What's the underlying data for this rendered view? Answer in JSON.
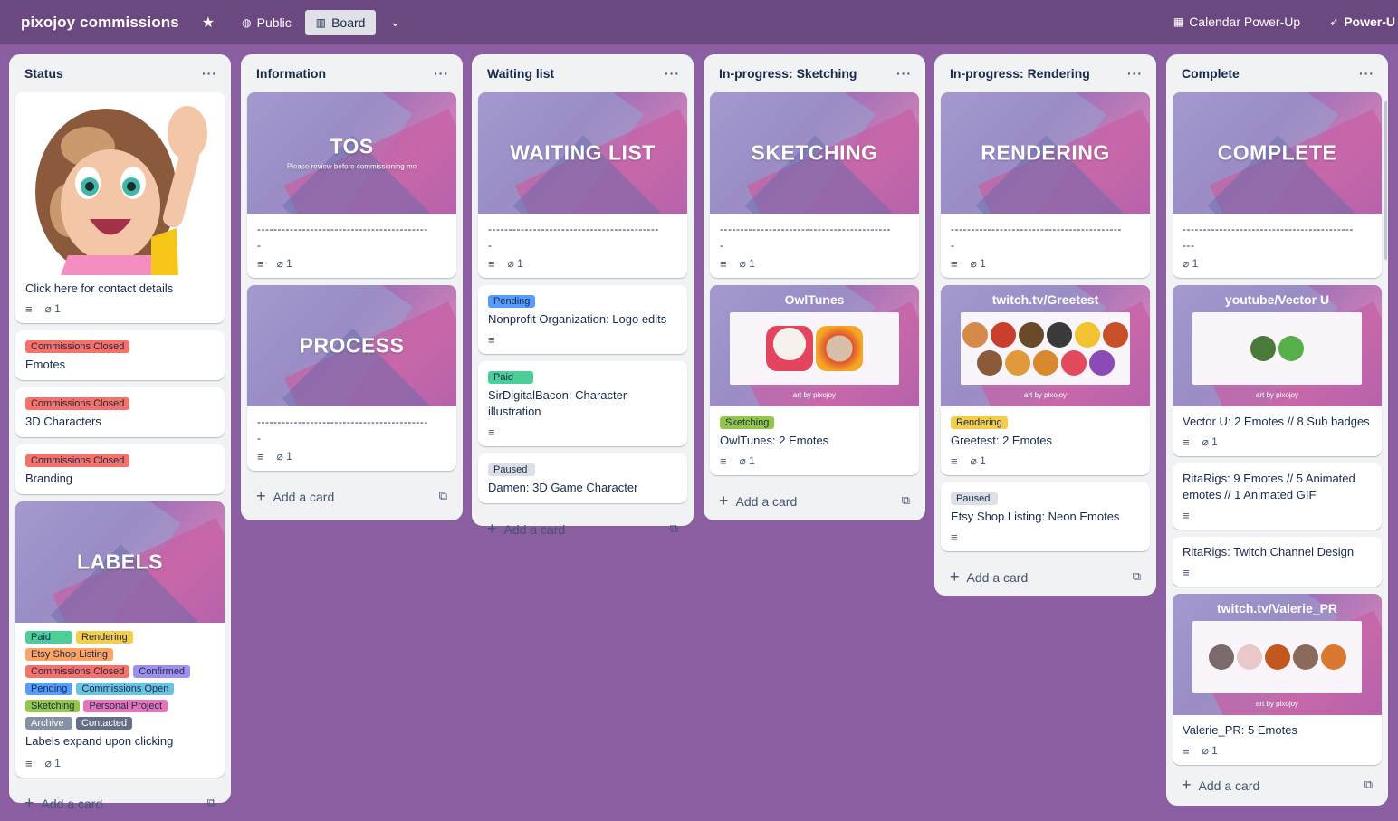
{
  "topbar": {
    "title": "pixojoy commissions",
    "visibility": "Public",
    "view": "Board",
    "calendar": "Calendar Power-Up",
    "powerups": "Power-U"
  },
  "colors": {
    "green": "#4bce97",
    "yellow": "#f5cd47",
    "orange": "#fea362",
    "red": "#f87168",
    "purple": "#9f8fef",
    "blue": "#579dff",
    "sky": "#6cc3e0",
    "lime": "#94c748",
    "pink": "#e774bb",
    "gray": "#8590a2",
    "dark": "#626f86",
    "paused": "#dcdfe4"
  },
  "lists": {
    "status": {
      "title": "Status",
      "card1": "Click here for contact details",
      "card1_att": "1",
      "emotes": {
        "label": "Commissions Closed",
        "title": "Emotes"
      },
      "chars": {
        "label": "Commissions Closed",
        "title": "3D Characters"
      },
      "brand": {
        "label": "Commissions Closed",
        "title": "Branding"
      },
      "labels_cover": "LABELS",
      "labels": [
        "Paid",
        "Rendering",
        "Etsy Shop Listing",
        "Commissions Closed",
        "Confirmed",
        "Pending",
        "Commissions Open",
        "Sketching",
        "Personal Project",
        "Archive",
        "Contacted"
      ],
      "labels_title": "Labels expand upon clicking",
      "labels_att": "1",
      "add": "Add a card"
    },
    "info": {
      "title": "Information",
      "tos_cover": "TOS",
      "tos_sub": "Please review before commissioning me",
      "tos_dash": "------------------------------------------",
      "tos_dash2": "-",
      "tos_att": "1",
      "process_cover": "PROCESS",
      "process_dash": "------------------------------------------",
      "process_dash2": "-",
      "process_att": "1",
      "add": "Add a card"
    },
    "waiting": {
      "title": "Waiting list",
      "cover": "WAITING LIST",
      "dash": "------------------------------------------",
      "dash2": "-",
      "att": "1",
      "c1_label": "Pending",
      "c1_title": "Nonprofit Organization: Logo edits",
      "c2_label": "Paid",
      "c2_title": "SirDigitalBacon: Character illustration",
      "c3_label": "Paused",
      "c3_title": "Damen: 3D Game Character",
      "add": "Add a card"
    },
    "sketching": {
      "title": "In-progress: Sketching",
      "cover": "SKETCHING",
      "dash": "------------------------------------------",
      "dash2": "-",
      "att": "1",
      "em_title": "OwlTunes",
      "em_foot": "art by pixojoy",
      "c1_label": "Sketching",
      "c1_title": "OwlTunes: 2 Emotes",
      "c1_att": "1",
      "add": "Add a card"
    },
    "rendering": {
      "title": "In-progress: Rendering",
      "cover": "RENDERING",
      "dash": "------------------------------------------",
      "dash2": "-",
      "att": "1",
      "em_title": "twitch.tv/Greetest",
      "em_foot": "art by pixojoy",
      "c1_label": "Rendering",
      "c1_title": "Greetest: 2 Emotes",
      "c1_att": "1",
      "c2_label": "Paused",
      "c2_title": "Etsy Shop Listing: Neon Emotes",
      "add": "Add a card"
    },
    "complete": {
      "title": "Complete",
      "cover": "COMPLETE",
      "dash": "------------------------------------------",
      "dash2": "---",
      "att": "1",
      "em1_title": "youtube/Vector U",
      "em_foot": "art by pixojoy",
      "c1_title": "Vector U: 2 Emotes // 8 Sub badges",
      "c1_att": "1",
      "c2_title": "RitaRigs: 9 Emotes // 5 Animated emotes // 1 Animated GIF",
      "c3_title": "RitaRigs: Twitch Channel Design",
      "em2_title": "twitch.tv/Valerie_PR",
      "c4_title": "Valerie_PR: 5 Emotes",
      "c4_att": "1",
      "add": "Add a card"
    }
  }
}
